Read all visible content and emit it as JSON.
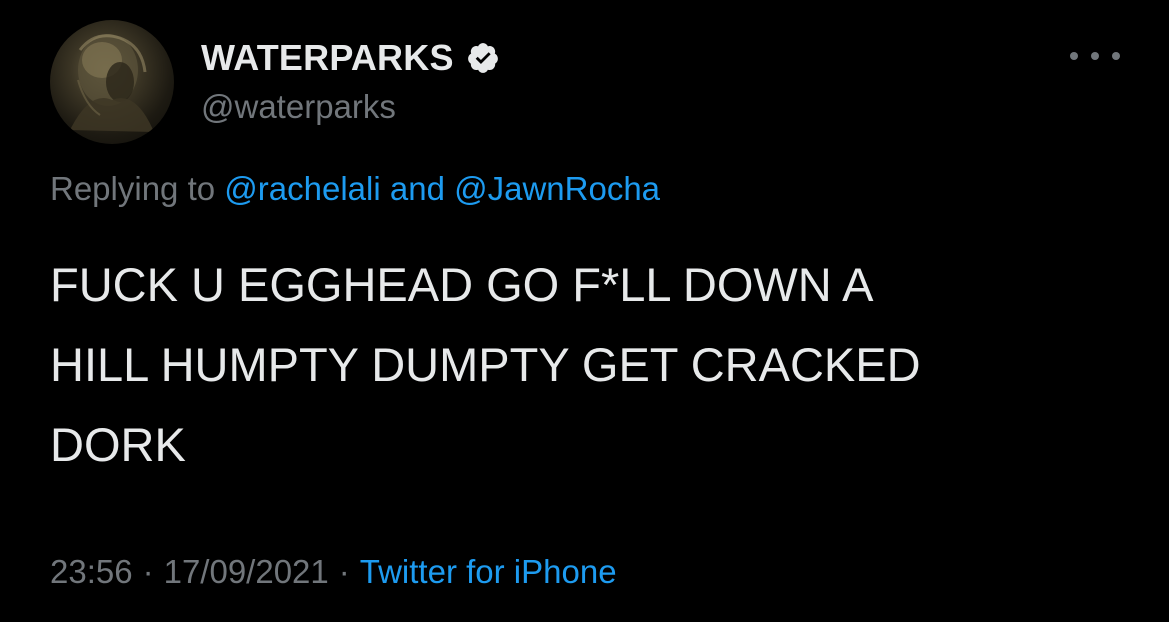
{
  "author": {
    "display_name": "WATERPARKS",
    "handle": "@waterparks",
    "verified_icon": "verified-badge-icon",
    "avatar": "profile-avatar"
  },
  "more_icon": "more-options-icon",
  "reply": {
    "prefix": "Replying to",
    "mention_1": "@rachelali",
    "connector": "and",
    "mention_2": "@JawnRocha"
  },
  "tweet": {
    "lines": [
      "FUCK U EGGHEAD GO F*LL DOWN A",
      "HILL HUMPTY DUMPTY GET CRACKED",
      "DORK"
    ]
  },
  "meta": {
    "time": "23:56",
    "separator": "·",
    "date": "17/09/2021",
    "source": "Twitter for iPhone"
  },
  "colors": {
    "background": "#000000",
    "primary_text": "#e7e9ea",
    "secondary_text": "#71767b",
    "link": "#1d9bf0"
  }
}
